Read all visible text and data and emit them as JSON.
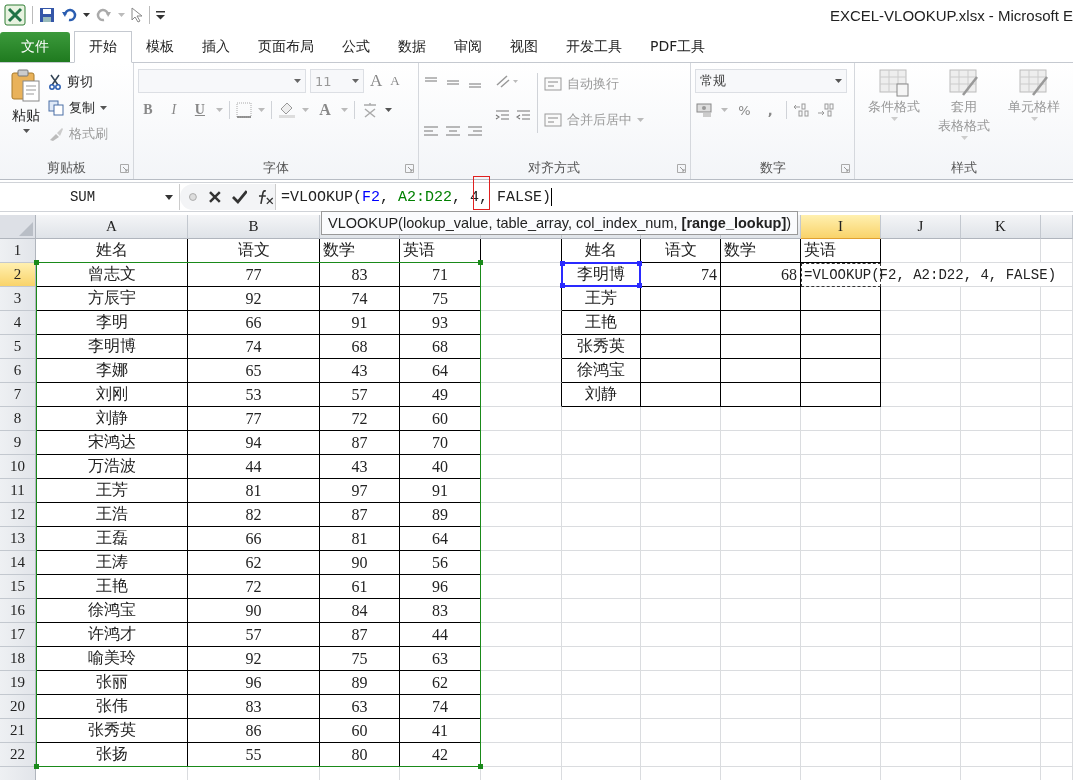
{
  "window": {
    "title": "EXCEL-VLOOKUP.xlsx - Microsoft E"
  },
  "tabs": [
    {
      "label": "文件",
      "kind": "file",
      "selected": false
    },
    {
      "label": "开始",
      "kind": "tab",
      "selected": true
    },
    {
      "label": "模板",
      "kind": "tab",
      "selected": false
    },
    {
      "label": "插入",
      "kind": "tab",
      "selected": false
    },
    {
      "label": "页面布局",
      "kind": "tab",
      "selected": false
    },
    {
      "label": "公式",
      "kind": "tab",
      "selected": false
    },
    {
      "label": "数据",
      "kind": "tab",
      "selected": false
    },
    {
      "label": "审阅",
      "kind": "tab",
      "selected": false
    },
    {
      "label": "视图",
      "kind": "tab",
      "selected": false
    },
    {
      "label": "开发工具",
      "kind": "tab",
      "selected": false
    },
    {
      "label": "PDF工具",
      "kind": "tab",
      "selected": false
    }
  ],
  "ribbon": {
    "clipboard": {
      "label": "剪贴板",
      "paste": "粘贴",
      "items": [
        {
          "label": "剪切",
          "disabled": false
        },
        {
          "label": "复制",
          "disabled": false
        },
        {
          "label": "格式刷",
          "disabled": true
        }
      ]
    },
    "font": {
      "label": "字体",
      "size": "11",
      "grow": "A",
      "shrink": "A",
      "styles": [
        "B",
        "I",
        "U"
      ],
      "color_letter": "A"
    },
    "alignment": {
      "label": "对齐方式",
      "items": [
        {
          "label": "自动换行",
          "disabled": true
        },
        {
          "label": "合并后居中",
          "disabled": true
        }
      ]
    },
    "number": {
      "label": "数字",
      "format": "常规",
      "percent": "%",
      "comma": ","
    },
    "styles": {
      "label": "样式",
      "items": [
        {
          "lines": [
            "条件格式"
          ]
        },
        {
          "lines": [
            "套用",
            "表格格式"
          ]
        },
        {
          "lines": [
            "单元格样"
          ]
        }
      ]
    }
  },
  "formula_bar": {
    "name_box": "SUM",
    "parts": [
      {
        "text": "=VLOOKUP("
      },
      {
        "text": "F2",
        "color": "#0000ff"
      },
      {
        "text": ", "
      },
      {
        "text": "A2:D22",
        "color": "#008000"
      },
      {
        "text": ", 4, FALSE)"
      }
    ]
  },
  "tooltip": "VLOOKUP(lookup_value, table_array, col_index_num, **[range_lookup]**)",
  "column_headers": [
    {
      "label": "A",
      "selected": false
    },
    {
      "label": "B",
      "selected": false
    },
    {
      "label": "I",
      "selected": true
    },
    {
      "label": "J",
      "selected": false
    },
    {
      "label": "K",
      "selected": false
    }
  ],
  "rows": [
    {
      "number": "1",
      "selected": false,
      "editing": false,
      "main": [
        "姓名",
        "语文",
        "数学",
        "英语"
      ],
      "lookup": [
        "姓名",
        "语文",
        "数学",
        "英语"
      ]
    },
    {
      "number": "2",
      "selected": true,
      "editing": true,
      "main": [
        "曾志文",
        "77",
        "83",
        "71"
      ],
      "lookup": [
        "李明博",
        "74",
        "68",
        "=VLOOKUP(F2, A2:D22, 4, FALSE)"
      ]
    },
    {
      "number": "3",
      "selected": false,
      "editing": false,
      "main": [
        "方辰宇",
        "92",
        "74",
        "75"
      ],
      "lookup": [
        "王芳"
      ]
    },
    {
      "number": "4",
      "selected": false,
      "editing": false,
      "main": [
        "李明",
        "66",
        "91",
        "93"
      ],
      "lookup": [
        "王艳"
      ]
    },
    {
      "number": "5",
      "selected": false,
      "editing": false,
      "main": [
        "李明博",
        "74",
        "68",
        "68"
      ],
      "lookup": [
        "张秀英"
      ]
    },
    {
      "number": "6",
      "selected": false,
      "editing": false,
      "main": [
        "李娜",
        "65",
        "43",
        "64"
      ],
      "lookup": [
        "徐鸿宝"
      ]
    },
    {
      "number": "7",
      "selected": false,
      "editing": false,
      "main": [
        "刘刚",
        "53",
        "57",
        "49"
      ],
      "lookup": [
        "刘静"
      ]
    },
    {
      "number": "8",
      "selected": false,
      "editing": false,
      "main": [
        "刘静",
        "77",
        "72",
        "60"
      ]
    },
    {
      "number": "9",
      "selected": false,
      "editing": false,
      "main": [
        "宋鸿达",
        "94",
        "87",
        "70"
      ]
    },
    {
      "number": "10",
      "selected": false,
      "editing": false,
      "main": [
        "万浩波",
        "44",
        "43",
        "40"
      ]
    },
    {
      "number": "11",
      "selected": false,
      "editing": false,
      "main": [
        "王芳",
        "81",
        "97",
        "91"
      ]
    },
    {
      "number": "12",
      "selected": false,
      "editing": false,
      "main": [
        "王浩",
        "82",
        "87",
        "89"
      ]
    },
    {
      "number": "13",
      "selected": false,
      "editing": false,
      "main": [
        "王磊",
        "66",
        "81",
        "64"
      ]
    },
    {
      "number": "14",
      "selected": false,
      "editing": false,
      "main": [
        "王涛",
        "62",
        "90",
        "56"
      ]
    },
    {
      "number": "15",
      "selected": false,
      "editing": false,
      "main": [
        "王艳",
        "72",
        "61",
        "96"
      ]
    },
    {
      "number": "16",
      "selected": false,
      "editing": false,
      "main": [
        "徐鸿宝",
        "90",
        "84",
        "83"
      ]
    },
    {
      "number": "17",
      "selected": false,
      "editing": false,
      "main": [
        "许鸿才",
        "57",
        "87",
        "44"
      ]
    },
    {
      "number": "18",
      "selected": false,
      "editing": false,
      "main": [
        "喻美玲",
        "92",
        "75",
        "63"
      ]
    },
    {
      "number": "19",
      "selected": false,
      "editing": false,
      "main": [
        "张丽",
        "96",
        "89",
        "62"
      ]
    },
    {
      "number": "20",
      "selected": false,
      "editing": false,
      "main": [
        "张伟",
        "83",
        "63",
        "74"
      ]
    },
    {
      "number": "21",
      "selected": false,
      "editing": false,
      "main": [
        "张秀英",
        "86",
        "60",
        "41"
      ]
    },
    {
      "number": "22",
      "selected": false,
      "editing": false,
      "main": [
        "张扬",
        "55",
        "80",
        "42"
      ]
    }
  ]
}
